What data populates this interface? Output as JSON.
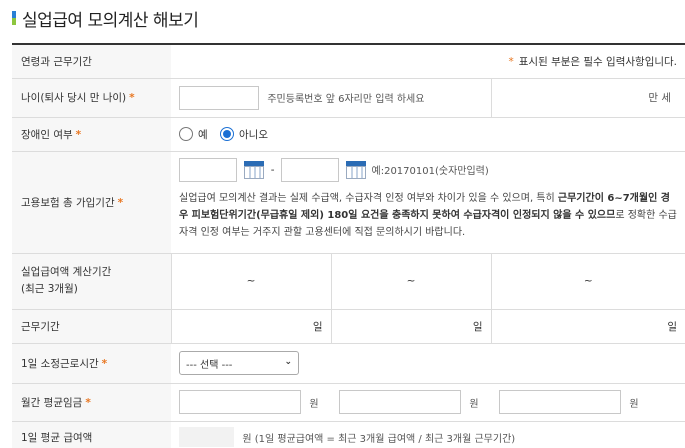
{
  "page": {
    "title": "실업급여 모의계산 해보기"
  },
  "rows": {
    "age_period": {
      "label": "연령과 근무기간",
      "required_note": "표시된 부분은 필수 입력사항입니다.",
      "star": "*"
    },
    "age": {
      "label": "나이(퇴사 당시 만 나이)",
      "hint": "주민등록번호 앞 6자리만 입력 하세요",
      "unit": "만 세",
      "value": ""
    },
    "disability": {
      "label": "장애인 여부",
      "options": [
        "예",
        "아니오"
      ],
      "selected": "아니오"
    },
    "insurance": {
      "label": "고용보험 총 가입기간",
      "dash": "-",
      "date_hint": "예:20170101(숫자만입력)",
      "notice_plain1": "실업급여 모의계산 결과는 실제 수급액, 수급자격 인정 여부와 차이가 있을 수 있으며, 특히 ",
      "notice_bold": "근무기간이 6~7개월인 경우 피보험단위기간(무급휴일 제외) 180일 요건을 충족하지 못하여 수급자격이 인정되지 않을 수 있으므",
      "notice_plain2": "로 정확한 수급자격 인정 여부는 거주지 관할 고용센터에 직접 문의하시기 바랍니다."
    },
    "calc_period": {
      "label_line1": "실업급여액 계산기간",
      "label_line2": "(최근 3개월)",
      "cells": [
        "~",
        "~",
        "~"
      ]
    },
    "work_period": {
      "label": "근무기간",
      "cells": [
        "일",
        "일",
        "일"
      ]
    },
    "daily_hours": {
      "label": "1일 소정근로시간",
      "select_value": "--- 선택 ---"
    },
    "monthly_wage": {
      "label": "월간 평균임금",
      "unit": "원"
    },
    "daily_avg": {
      "label": "1일 평균 급여액",
      "formula": "원 (1일 평균급여액 = 최근 3개월 급여액 / 최근 3개월 근무기간)"
    }
  }
}
